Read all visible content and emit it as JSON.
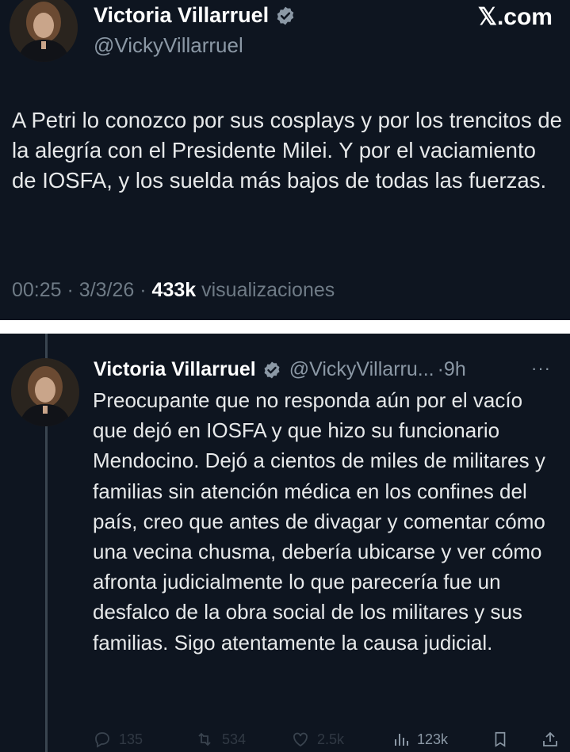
{
  "top_post": {
    "author": {
      "name": "Victoria Villarruel",
      "handle": "@VickyVillarruel",
      "verified": true
    },
    "brand": "𝕏.com",
    "text": "A Petri lo conozco por sus cosplays y por los trencitos de la alegría con el Presidente Milei. Y por el vaciamiento de IOSFA, y los suelda más bajos de todas las fuerzas.",
    "meta": {
      "time": "00:25",
      "date": "3/3/26",
      "views_count": "433k",
      "views_label": "visualizaciones",
      "separator": "·"
    }
  },
  "reply_post": {
    "author": {
      "name": "Victoria Villarruel",
      "handle": "@VickyVillarru...",
      "verified": true
    },
    "separator": "·",
    "time": "9h",
    "more": "···",
    "text": "Preocupante que no responda aún por el vacío que dejó en IOSFA y que hizo su funcionario Mendocino. Dejó a cientos de miles de militares y familias sin atención médica en los confines del país, creo que antes de divagar y comentar cómo una vecina chusma, debería ubicarse y ver cómo afronta judicialmente lo que parecería fue un desfalco de la obra social de los militares y sus familias. Sigo atentamente la causa judicial.",
    "actions": {
      "replies": "135",
      "retweets": "534",
      "likes": "2.5k",
      "views": "123k"
    }
  },
  "colors": {
    "background": "#0e1520",
    "text": "#e7e9ea",
    "muted": "#8b98a5",
    "verified_badge": "#8b98a5",
    "divider": "#ffffff"
  },
  "icons": [
    "verified-badge-icon",
    "x-logo",
    "reply-icon",
    "retweet-icon",
    "like-icon",
    "views-icon",
    "bookmark-icon",
    "share-icon",
    "more-icon"
  ]
}
